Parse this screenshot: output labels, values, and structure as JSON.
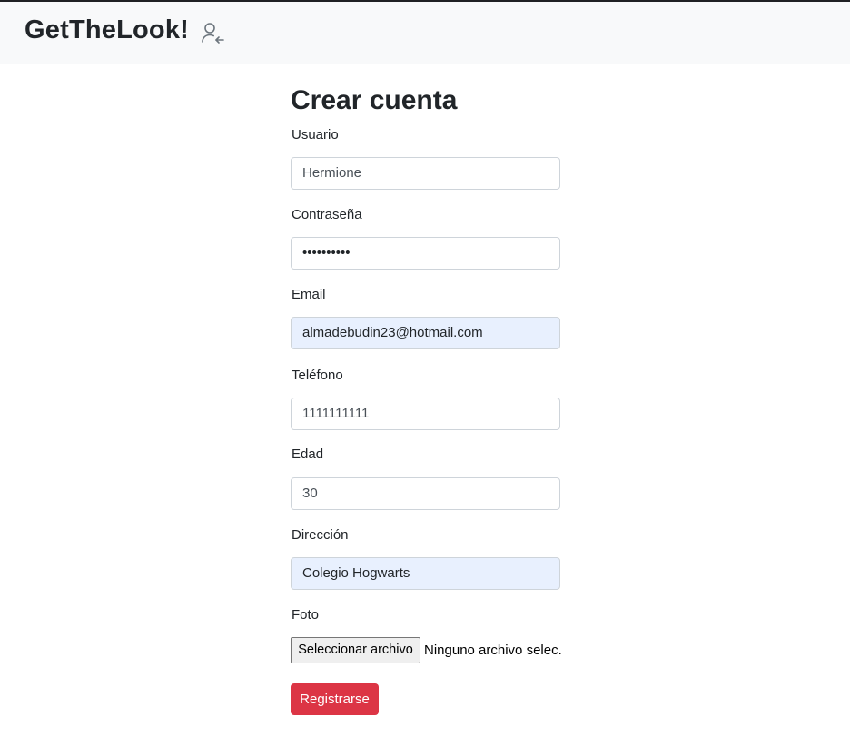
{
  "navbar": {
    "brand": "GetTheLook!",
    "login_icon": "user-arrow-left-icon"
  },
  "form": {
    "title": "Crear cuenta",
    "fields": {
      "usuario": {
        "label": "Usuario",
        "value": "Hermione",
        "autofilled": false
      },
      "contrasena": {
        "label": "Contraseña",
        "value": "••••••••••",
        "type": "password",
        "autofilled": false
      },
      "email": {
        "label": "Email",
        "value": "almadebudin23@hotmail.com",
        "autofilled": true
      },
      "telefono": {
        "label": "Teléfono",
        "value": "1111111111",
        "autofilled": false
      },
      "edad": {
        "label": "Edad",
        "value": "30",
        "autofilled": false
      },
      "direccion": {
        "label": "Dirección",
        "value": "Colegio Hogwarts",
        "autofilled": true
      },
      "foto": {
        "label": "Foto",
        "button_label": "Seleccionar archivo",
        "status": "Ninguno archivo selec."
      }
    },
    "submit_label": "Registrarse"
  },
  "colors": {
    "navbar_bg": "#f8f9fa",
    "autofill_bg": "#e8f0fe",
    "submit_bg": "#dc3545",
    "input_border": "#ced4da"
  }
}
